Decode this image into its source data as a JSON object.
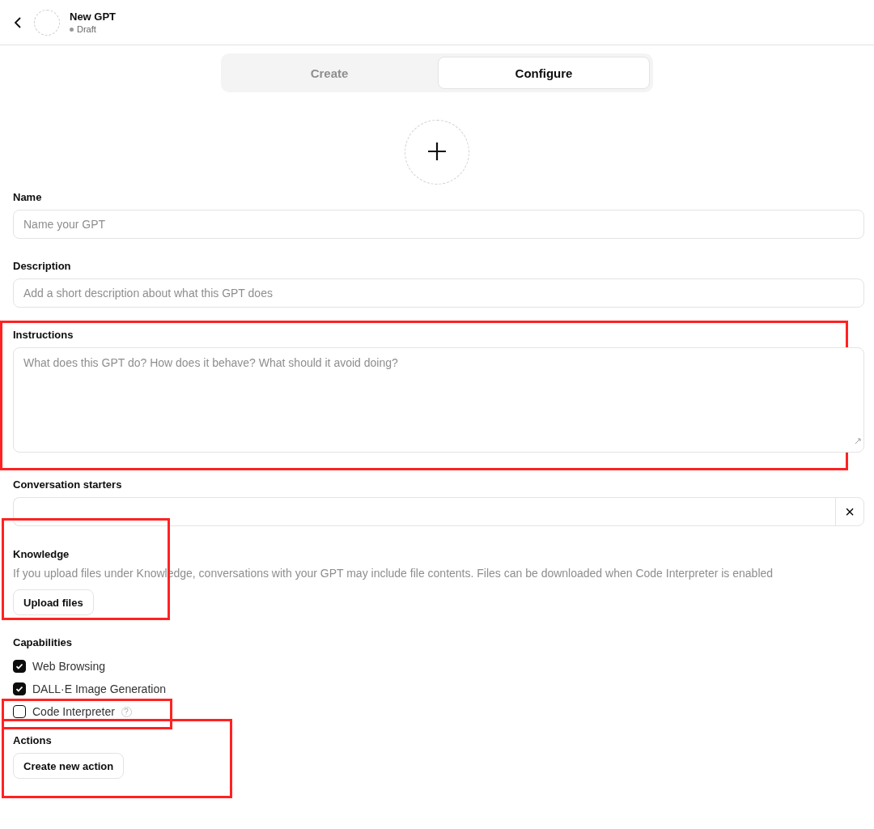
{
  "header": {
    "title": "New GPT",
    "status": "Draft"
  },
  "tabs": [
    {
      "label": "Create",
      "selected": false
    },
    {
      "label": "Configure",
      "selected": true
    }
  ],
  "name": {
    "label": "Name",
    "placeholder": "Name your GPT"
  },
  "description": {
    "label": "Description",
    "placeholder": "Add a short description about what this GPT does"
  },
  "instructions": {
    "label": "Instructions",
    "placeholder": "What does this GPT do? How does it behave? What should it avoid doing?",
    "highlighted": true
  },
  "conversation_starters": {
    "label": "Conversation starters",
    "remove_button": "×"
  },
  "knowledge": {
    "label": "Knowledge",
    "hint": "If you upload files under Knowledge, conversations with your GPT may include file contents. Files can be downloaded when Code Interpreter is enabled",
    "button": "Upload files",
    "highlighted": true
  },
  "capabilities": {
    "label": "Capabilities",
    "items": [
      {
        "label": "Web Browsing",
        "checked": true,
        "help": false,
        "highlighted": false
      },
      {
        "label": "DALL·E Image Generation",
        "checked": true,
        "help": false,
        "highlighted": false
      },
      {
        "label": "Code Interpreter",
        "checked": false,
        "help": true,
        "highlighted": true
      }
    ]
  },
  "actions": {
    "label": "Actions",
    "button": "Create new action",
    "highlighted": true
  }
}
